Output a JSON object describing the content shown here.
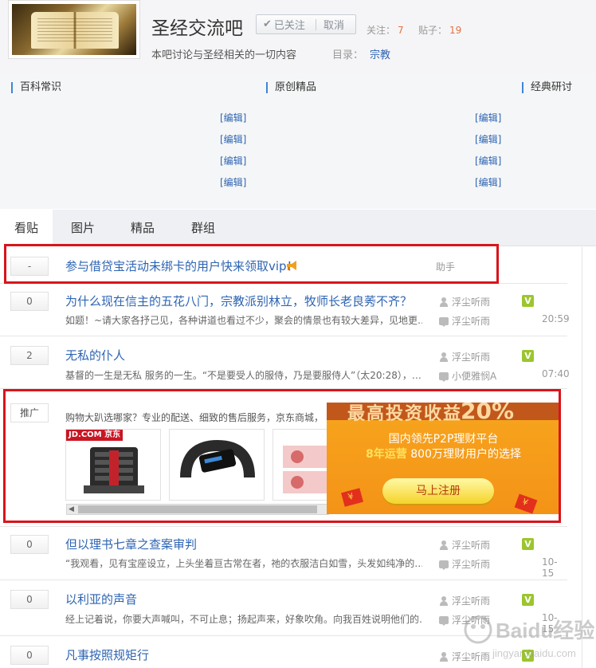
{
  "forum": {
    "title": "圣经交流吧",
    "followed_label": "已关注",
    "cancel_label": "取消",
    "follow_count_label": "关注：",
    "follow_count": "7",
    "post_count_label": "贴子：",
    "post_count": "19",
    "description": "本吧讨论与圣经相关的一切内容",
    "directory_label": "目录：",
    "directory_value": "宗教"
  },
  "categories": [
    {
      "title": "百科常识",
      "edit_label": "[编辑]"
    },
    {
      "title": "原创精品",
      "edit_label": "[编辑]"
    },
    {
      "title": "经典研讨"
    }
  ],
  "tabs": [
    {
      "label": "看贴"
    },
    {
      "label": "图片"
    },
    {
      "label": "精品"
    },
    {
      "label": "群组"
    }
  ],
  "announcement": {
    "pin_label": "-",
    "title": "参与借贷宝活动未绑卡的用户快来领取vip！",
    "author": "助手"
  },
  "threads": [
    {
      "replies": "0",
      "title": "为什么现在信主的五花八门，宗教派别林立，牧师长老良莠不齐？",
      "abstract": "如题！~请大家各抒己见，各种讲道也看过不少，聚会的情景也有较大差异，见地更…",
      "author": "浮尘听雨",
      "last_reply": "浮尘听雨",
      "time": "20:59",
      "level": "V"
    },
    {
      "replies": "2",
      "title": "无私的仆人",
      "abstract": "基督的一生是无私 服务的一生。“不是要受人的服侍，乃是要服侍人”（太20:28），…",
      "author": "浮尘听雨",
      "last_reply": "小便雅悯A",
      "time": "07:40",
      "level": "V"
    },
    {
      "replies": "0",
      "title": "但以理书七章之查案审判",
      "abstract": "“我观看，见有宝座设立，上头坐着亘古常在者，祂的衣服洁白如雪，头发如纯净的…",
      "author": "浮尘听雨",
      "last_reply": "浮尘听雨",
      "time": "10-15",
      "level": "V"
    },
    {
      "replies": "0",
      "title": "以利亚的声音",
      "abstract": "经上记着说，你要大声喊叫，不可止息；扬起声来，好象吹角。向我百姓说明他们的…",
      "author": "浮尘听雨",
      "last_reply": "浮尘听雨",
      "time": "10-15",
      "level": "V"
    },
    {
      "replies": "0",
      "title": "凡事按照规矩行",
      "author": "浮尘听雨",
      "level": "V"
    }
  ],
  "ad": {
    "tag": "推广",
    "text": "购物大趴选哪家？专业的配送、细致的售后服务，京东商城，",
    "jd_label": "JD.COM 京东",
    "banner_top_text": "最高投资收益",
    "banner_top_pct": "20%",
    "banner_line1": "国内领先P2P理财平台",
    "banner_line2_a": "8年运营",
    "banner_line2_b": "800万理财用户的选择",
    "banner_button": "马上注册"
  },
  "watermark": {
    "brand": "Baidu经验",
    "url": "jingyan.baidu.com"
  },
  "colors": {
    "link_blue": "#2d64b3",
    "accent_orange": "#e27344",
    "highlight_red": "#d9141b",
    "level_green": "#9bc62d",
    "banner_orange": "#f49317"
  }
}
